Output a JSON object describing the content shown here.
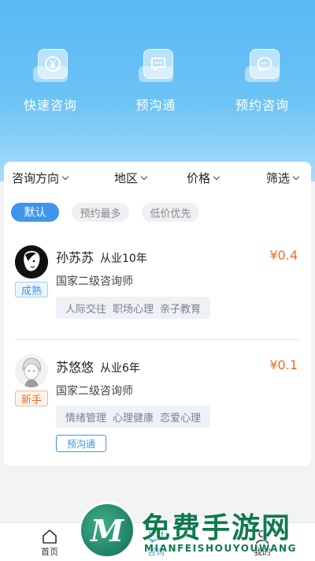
{
  "quick_actions": [
    {
      "label": "快速咨询",
      "icon": "yen-chat-icon"
    },
    {
      "label": "预沟通",
      "icon": "message-dots-icon"
    },
    {
      "label": "预约咨询",
      "icon": "chat-bubble-icon"
    }
  ],
  "filters": {
    "direction": "咨询方向",
    "region": "地区",
    "price": "价格",
    "filter": "筛选"
  },
  "sort_chips": {
    "default": "默认",
    "most_booked": "预约最多",
    "low_price": "低价优先"
  },
  "counselors": [
    {
      "level": "成熟",
      "name": "孙苏苏",
      "experience": "从业10年",
      "price": "¥0.4",
      "title": "国家二级咨询师",
      "tags": [
        "人际交往",
        "职场心理",
        "亲子教育"
      ]
    },
    {
      "level": "新手",
      "name": "苏悠悠",
      "experience": "从业6年",
      "price": "¥0.1",
      "title": "国家二级咨询师",
      "tags": [
        "情绪管理",
        "心理健康",
        "恋爱心理"
      ],
      "badge": "预沟通"
    }
  ],
  "tabbar": {
    "home": "首页",
    "consult": "咨询",
    "mine": "我的"
  },
  "watermark": {
    "logo_letter": "M",
    "text": "免费手游网",
    "sub": "MIANFEISHOUYOUWANG"
  },
  "colors": {
    "accent": "#3f95ec",
    "price": "#f06b2a",
    "hero": "#59b9f3"
  }
}
